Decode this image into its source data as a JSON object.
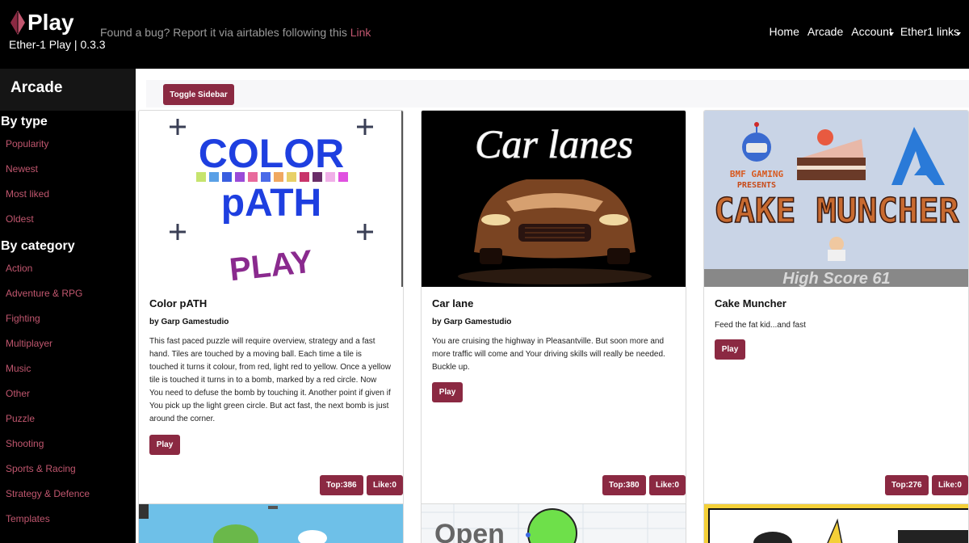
{
  "header": {
    "brand": "Play",
    "version": "Ether-1 Play | 0.3.3",
    "bug_note": "Found a bug? Report it via airtables following this",
    "bug_link": "Link",
    "nav": [
      "Home",
      "Arcade",
      "Account",
      "Ether1 links"
    ]
  },
  "sidebar": {
    "title": "Arcade",
    "by_type_label": "By type",
    "by_type": [
      "Popularity",
      "Newest",
      "Most liked",
      "Oldest"
    ],
    "by_category_label": "By category",
    "by_category": [
      "Action",
      "Adventure & RPG",
      "Fighting",
      "Multiplayer",
      "Music",
      "Other",
      "Puzzle",
      "Shooting",
      "Sports & Racing",
      "Strategy & Defence",
      "Templates"
    ]
  },
  "toolbar": {
    "toggle_label": "Toggle Sidebar"
  },
  "games": [
    {
      "title": "Color pATH",
      "author": "by Garp Gamestudio",
      "description": "This fast paced puzzle will require overview, strategy and a fast hand. Tiles are touched by a moving ball. Each time a tile is touched it turns it colour, from red, light red to yellow. Once a yellow tile is touched it turns in to a bomb, marked by a red circle. Now You need to defuse the bomb by touching it. Another point if given if You pick up the light green circle. But act fast, the next bomb is just around the corner.",
      "play_label": "Play",
      "top": "Top:386",
      "like": "Like:0",
      "image_text_1": "COLOR",
      "image_text_2": "pATH",
      "image_text_3": "PLAY"
    },
    {
      "title": "Car lane",
      "author": "by Garp Gamestudio",
      "description": "You are cruising the highway in Pleasantville. But soon more and more traffic will come and Your driving skills will really be needed. Buckle up.",
      "play_label": "Play",
      "top": "Top:380",
      "like": "Like:0",
      "image_text_1": "Car lanes"
    },
    {
      "title": "Cake Muncher",
      "author": "",
      "description": "Feed the fat kid...and fast",
      "play_label": "Play",
      "top": "Top:276",
      "like": "Like:0",
      "image_text_1": "BMF GAMING",
      "image_text_2": "PRESENTS",
      "image_text_3": "CAKE MUNCHER",
      "image_text_4": "High Score 61"
    }
  ],
  "row2": {
    "open_text": "Open"
  },
  "colors": {
    "accent": "#8b2942",
    "link": "#c0566e",
    "header_bg": "#000000"
  }
}
